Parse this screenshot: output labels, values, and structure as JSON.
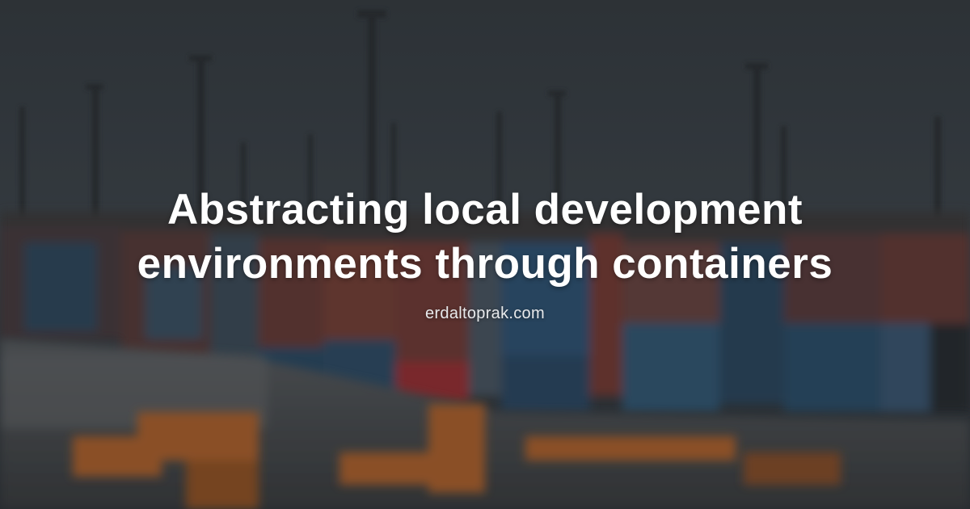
{
  "post": {
    "title_line1": "Abstracting local development",
    "title_line2": "environments through containers",
    "site": "erdaltoprak.com"
  },
  "colors": {
    "sky": "#3b4147",
    "text": "#ffffff",
    "container_red": "#8a3b34",
    "container_blue": "#2f4d63",
    "crane_orange": "#b8652a"
  }
}
